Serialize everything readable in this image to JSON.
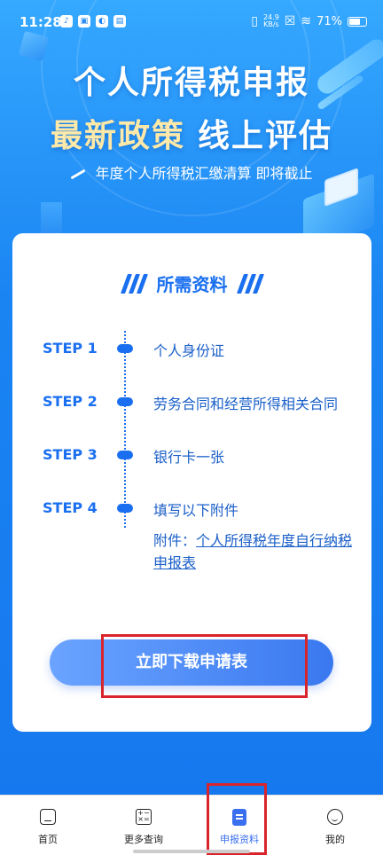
{
  "status_bar": {
    "time": "11:28",
    "net_speed_value": "24.9",
    "net_speed_unit": "KB/s",
    "battery": "71%",
    "battery_level": 0.71
  },
  "hero": {
    "title": "个人所得税申报",
    "subtitle_highlight": "最新政策",
    "subtitle_rest": "线上评估",
    "tagline": "年度个人所得税汇缴清算 即将截止"
  },
  "card": {
    "section_title": "所需资料",
    "steps": [
      {
        "label": "STEP 1",
        "text": "个人身份证"
      },
      {
        "label": "STEP 2",
        "text": "劳务合同和经营所得相关合同"
      },
      {
        "label": "STEP 3",
        "text": "银行卡一张"
      },
      {
        "label": "STEP 4",
        "text": "填写以下附件"
      }
    ],
    "attachment_prefix": "附件：",
    "attachment_link": "个人所得税年度自行纳税申报表",
    "download_button": "立即下载申请表"
  },
  "bottom_nav": {
    "items": [
      {
        "label": "首页",
        "icon": "home-icon"
      },
      {
        "label": "更多查询",
        "icon": "calculator-icon"
      },
      {
        "label": "申报资料",
        "icon": "document-icon",
        "active": true
      },
      {
        "label": "我的",
        "icon": "smiley-icon"
      }
    ]
  },
  "colors": {
    "accent": "#1a6ff0",
    "highlight_box": "#d9242b",
    "warm_title": "#ffe9a8"
  }
}
